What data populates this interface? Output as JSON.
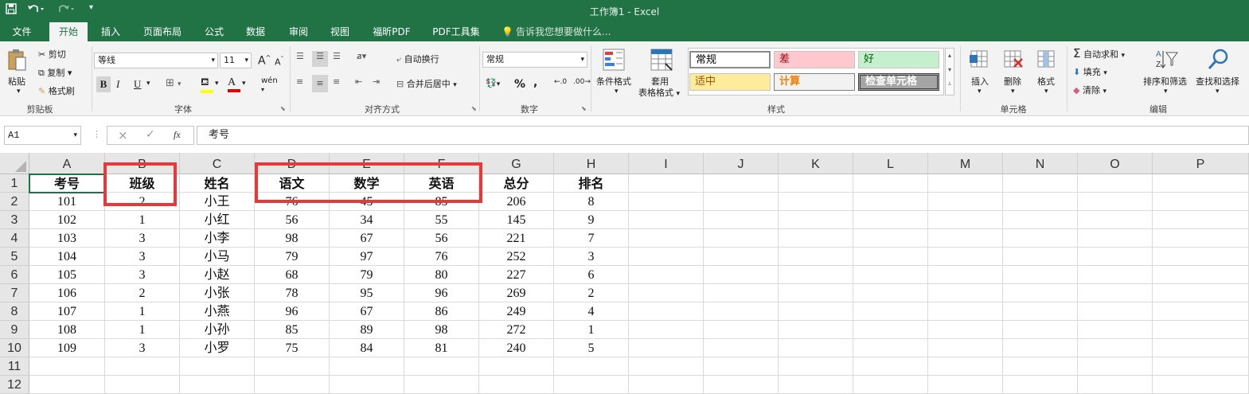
{
  "title_bar": {
    "window_title": "工作簿1 - Excel",
    "quick_access": [
      "save-icon",
      "undo-icon",
      "redo-icon",
      "customize-icon"
    ],
    "bg_color": "#217346"
  },
  "tabs": [
    "文件",
    "开始",
    "插入",
    "页面布局",
    "公式",
    "数据",
    "审阅",
    "视图",
    "福昕PDF",
    "PDF工具集"
  ],
  "active_tab": "开始",
  "tell_me": "告诉我您想要做什么...",
  "ribbon": {
    "clipboard": {
      "paste": "粘贴",
      "cut": "剪切",
      "copy": "复制",
      "format_painter": "格式刷",
      "label": "剪贴板"
    },
    "font": {
      "name": "等线",
      "size": "11",
      "label": "字体",
      "bold": "B",
      "italic": "I",
      "underline": "U",
      "grow": "A",
      "shrink": "A",
      "phonetic": "wén"
    },
    "alignment": {
      "wrap": "自动换行",
      "merge": "合并后居中",
      "label": "对齐方式"
    },
    "number": {
      "format": "常规",
      "percent": "%",
      "comma": ",",
      "label": "数字"
    },
    "styles": {
      "conditional": "条件格式",
      "table_format_1": "套用",
      "table_format_2": "表格格式",
      "cells": [
        "常规",
        "差",
        "好",
        "适中",
        "计算",
        "检查单元格"
      ],
      "label": "样式"
    },
    "cells": {
      "insert": "插入",
      "delete": "删除",
      "format": "格式",
      "label": "单元格"
    },
    "editing": {
      "autosum": "自动求和",
      "fill": "填充",
      "clear": "清除",
      "sort_filter": "排序和筛选",
      "find_select": "查找和选择",
      "label": "编辑"
    }
  },
  "formula_bar": {
    "name_box": "A1",
    "cancel": "×",
    "enter": "✓",
    "fx": "fx",
    "content": "考号"
  },
  "sheet": {
    "columns": [
      "A",
      "B",
      "C",
      "D",
      "E",
      "F",
      "G",
      "H",
      "I",
      "J",
      "K",
      "L",
      "M",
      "N",
      "O",
      "P"
    ],
    "rows": [
      "1",
      "2",
      "3",
      "4",
      "5",
      "6",
      "7",
      "8",
      "9",
      "10",
      "11",
      "12"
    ],
    "header": [
      "考号",
      "班级",
      "姓名",
      "语文",
      "数学",
      "英语",
      "总分",
      "排名"
    ],
    "data": [
      [
        "101",
        "2",
        "小王",
        "76",
        "45",
        "85",
        "206",
        "8"
      ],
      [
        "102",
        "1",
        "小红",
        "56",
        "34",
        "55",
        "145",
        "9"
      ],
      [
        "103",
        "3",
        "小李",
        "98",
        "67",
        "56",
        "221",
        "7"
      ],
      [
        "104",
        "3",
        "小马",
        "79",
        "97",
        "76",
        "252",
        "3"
      ],
      [
        "105",
        "3",
        "小赵",
        "68",
        "79",
        "80",
        "227",
        "6"
      ],
      [
        "106",
        "2",
        "小张",
        "78",
        "95",
        "96",
        "269",
        "2"
      ],
      [
        "107",
        "1",
        "小燕",
        "96",
        "67",
        "86",
        "249",
        "4"
      ],
      [
        "108",
        "1",
        "小孙",
        "85",
        "89",
        "98",
        "272",
        "1"
      ],
      [
        "109",
        "3",
        "小罗",
        "75",
        "84",
        "81",
        "240",
        "5"
      ]
    ],
    "highlight_color": "#e8393a"
  }
}
